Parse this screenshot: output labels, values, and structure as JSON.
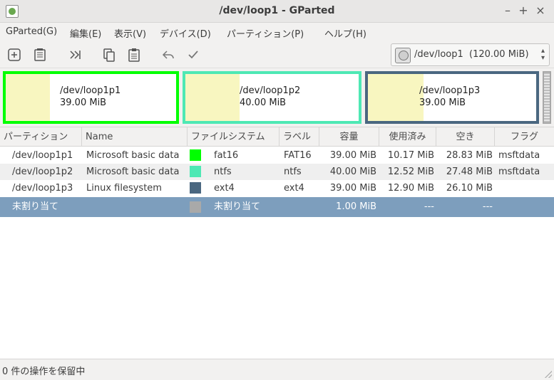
{
  "window": {
    "title": "/dev/loop1 - GParted",
    "minimize": "–",
    "maximize": "+",
    "close": "×"
  },
  "menu": [
    "GParted(G)",
    "編集(E)",
    "表示(V)",
    "デバイス(D)",
    "パーティション(P)",
    "ヘルプ(H)"
  ],
  "toolbar": {
    "buttons": [
      "new-icon",
      "delete-icon",
      "resize-icon",
      "copy-icon",
      "paste-icon",
      "undo-icon",
      "apply-icon"
    ],
    "device": "/dev/loop1",
    "device_size": "(120.00 MiB)"
  },
  "diskmap": [
    {
      "name": "/dev/loop1p1",
      "size": "39.00 MiB",
      "color": "#00ff00",
      "used_fraction": 0.261
    },
    {
      "name": "/dev/loop1p2",
      "size": "40.00 MiB",
      "color": "#4ee8b4",
      "used_fraction": 0.313
    },
    {
      "name": "/dev/loop1p3",
      "size": "39.00 MiB",
      "color": "#4a6780",
      "used_fraction": 0.331
    }
  ],
  "table": {
    "headers": [
      "パーティション",
      "Name",
      "ファイルシステム",
      "ラベル",
      "容量",
      "使用済み",
      "空き",
      "フラグ"
    ],
    "rows": [
      {
        "partition": "/dev/loop1p1",
        "name": "Microsoft basic data",
        "color": "#00ff00",
        "fs": "fat16",
        "label": "FAT16",
        "size": "39.00 MiB",
        "used": "10.17 MiB",
        "free": "28.83 MiB",
        "flags": "msftdata"
      },
      {
        "partition": "/dev/loop1p2",
        "name": "Microsoft basic data",
        "color": "#4ee8b4",
        "fs": "ntfs",
        "label": "ntfs",
        "size": "40.00 MiB",
        "used": "12.52 MiB",
        "free": "27.48 MiB",
        "flags": "msftdata"
      },
      {
        "partition": "/dev/loop1p3",
        "name": "Linux filesystem",
        "color": "#4a6780",
        "fs": "ext4",
        "label": "ext4",
        "size": "39.00 MiB",
        "used": "12.90 MiB",
        "free": "26.10 MiB",
        "flags": ""
      },
      {
        "partition": "未割り当て",
        "name": "",
        "color": "#a9a9a9",
        "fs": "未割り当て",
        "label": "",
        "size": "1.00 MiB",
        "used": "---",
        "free": "---",
        "flags": ""
      }
    ]
  },
  "status": "0 件の操作を保留中"
}
